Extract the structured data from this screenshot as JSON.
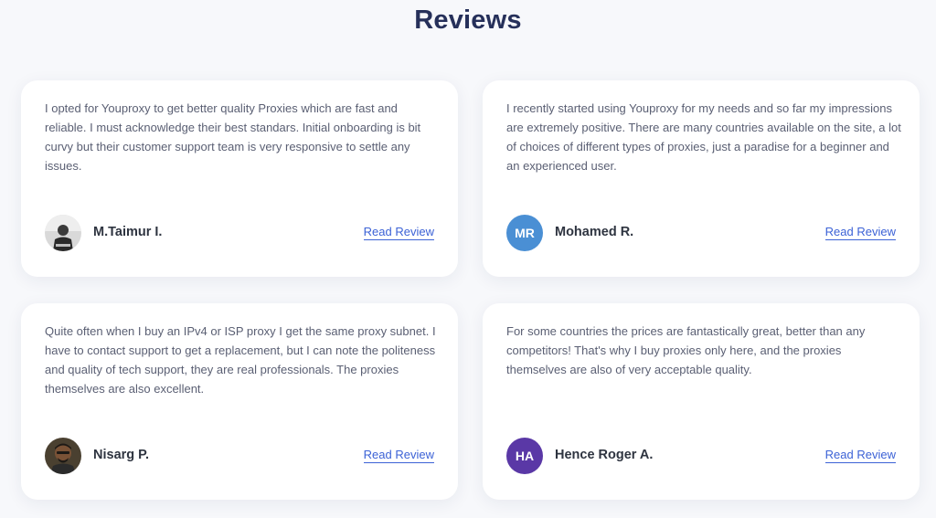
{
  "section": {
    "title": "Reviews"
  },
  "reviews": [
    {
      "text": "I opted for Youproxy to get better quality Proxies which are fast and reliable. I must acknowledge their best standars. Initial onboarding is bit curvy but their customer support team is very responsive to settle any issues.",
      "name": "M.Taimur I.",
      "avatar": {
        "type": "photo",
        "icon": "user-photo"
      },
      "link_label": "Read Review"
    },
    {
      "text": "I recently started using Youproxy for my needs and so far my impressions are extremely positive. There are many countries available on the site, a lot of choices of different types of proxies, just a paradise for a beginner and an experienced user.",
      "name": "Mohamed R.",
      "avatar": {
        "type": "initials",
        "initials": "MR",
        "color": "#4a8fd4"
      },
      "link_label": "Read Review"
    },
    {
      "text": "Quite often when I buy an IPv4 or ISP proxy I get the same proxy subnet. I have to contact support to get a replacement, but I can note the politeness and quality of tech support, they are real professionals. The proxies themselves are also excellent.",
      "name": "Nisarg P.",
      "avatar": {
        "type": "photo",
        "icon": "user-photo"
      },
      "link_label": "Read Review"
    },
    {
      "text": "For some countries the prices are fantastically great, better than any competitors! That's why I buy proxies only here, and the proxies themselves are also of very acceptable quality.",
      "name": "Hence Roger A.",
      "avatar": {
        "type": "initials",
        "initials": "HA",
        "color": "#5a38a6"
      },
      "link_label": "Read Review"
    }
  ],
  "colors": {
    "title": "#26305a",
    "link": "#3c62d6",
    "background": "#f7f8fb"
  }
}
